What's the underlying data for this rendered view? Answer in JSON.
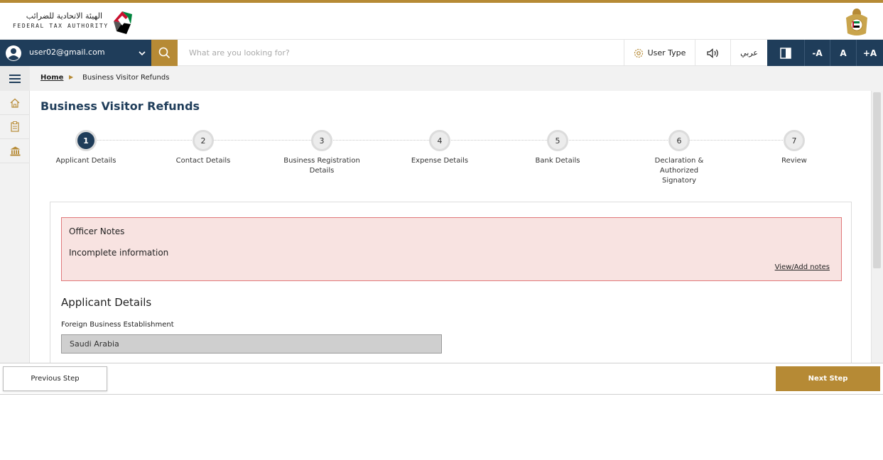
{
  "header": {
    "logo_arabic": "الهيئة الاتحادية للضرائب",
    "logo_english": "FEDERAL TAX AUTHORITY",
    "brand_color": "#b68a35",
    "navy_color": "#1f3d5a"
  },
  "toolbar": {
    "user_email": "user02@gmail.com",
    "search_placeholder": "What are you looking for?",
    "user_type_label": "User Type",
    "arabic_label": "عربي",
    "font_decrease": "-A",
    "font_normal": "A",
    "font_increase": "+A"
  },
  "breadcrumb": {
    "home": "Home",
    "current": "Business Visitor Refunds"
  },
  "page": {
    "title": "Business Visitor Refunds"
  },
  "steps": [
    {
      "number": "1",
      "label": "Applicant Details",
      "active": true
    },
    {
      "number": "2",
      "label": "Contact Details",
      "active": false
    },
    {
      "number": "3",
      "label": "Business Registration Details",
      "active": false
    },
    {
      "number": "4",
      "label": "Expense Details",
      "active": false
    },
    {
      "number": "5",
      "label": "Bank Details",
      "active": false
    },
    {
      "number": "6",
      "label": "Declaration & Authorized Signatory",
      "active": false
    },
    {
      "number": "7",
      "label": "Review",
      "active": false
    }
  ],
  "officer_notes": {
    "title": "Officer Notes",
    "text": "Incomplete information",
    "link": "View/Add notes"
  },
  "applicant": {
    "section_title": "Applicant Details",
    "field_label": "Foreign Business Establishment",
    "field_value": "Saudi Arabia"
  },
  "footer": {
    "previous": "Previous Step",
    "next": "Next Step"
  }
}
